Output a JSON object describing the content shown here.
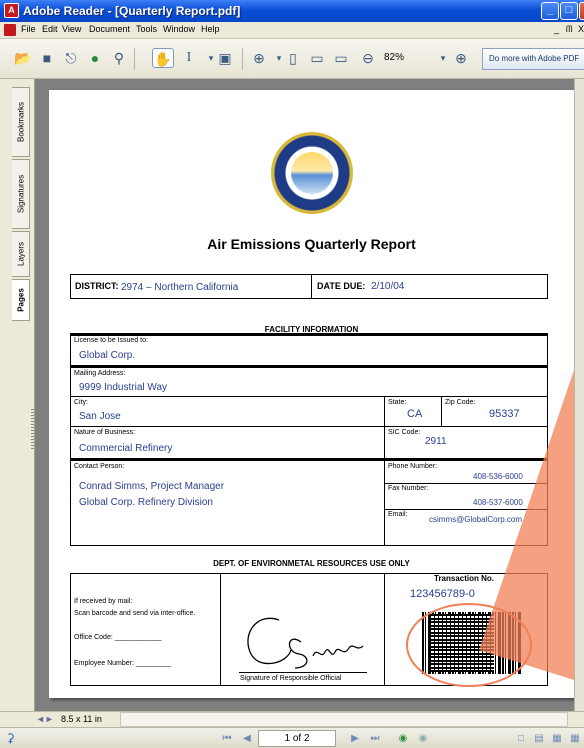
{
  "window": {
    "title": "Adobe Reader - [Quarterly Report.pdf]",
    "min": "_",
    "max": "□",
    "close": "X"
  },
  "menu": {
    "items": [
      "File",
      "Edit",
      "View",
      "Document",
      "Tools",
      "Window",
      "Help"
    ],
    "doc_min": "_",
    "doc_restore": "ᗰ",
    "doc_close": "X"
  },
  "toolbar": {
    "zoom": "82%",
    "promo": "Do more with Adobe PDF"
  },
  "nav": {
    "tabs": [
      "Bookmarks",
      "Signatures",
      "Layers",
      "Pages"
    ],
    "active": "Pages"
  },
  "document": {
    "title": "Air Emissions Quarterly Report",
    "district_label": "DISTRICT:",
    "district_value": "2974 – Northern California",
    "date_due_label": "DATE DUE:",
    "date_due_value": "2/10/04",
    "facility_header": "FACILITY INFORMATION",
    "license_label": "License to be Issued to:",
    "license_value": "Global Corp.",
    "mailing_label": "Mailing Address:",
    "mailing_value": "9999 Industrial Way",
    "city_label": "City:",
    "city_value": "San Jose",
    "state_label": "State:",
    "state_value": "CA",
    "zip_label": "Zip Code:",
    "zip_value": "95337",
    "nature_label": "Nature of Business:",
    "nature_value": "Commercial Refinery",
    "sic_label": "SIC Code:",
    "sic_value": "2911",
    "contact_label": "Contact Person:",
    "contact_line1": "Conrad Simms, Project Manager",
    "contact_line2": "Global Corp. Refinery Division",
    "phone_label": "Phone Number:",
    "phone_value": "408-536-6000",
    "fax_label": "Fax Number:",
    "fax_value": "408-537-6000",
    "email_label": "Email:",
    "email_value": "csimms@GlobalCorp.com",
    "dept_header": "DEPT. OF ENVIRONMETAL RESOURCES USE ONLY",
    "mail_line1": "If received by mail:",
    "mail_line2": "Scan barcode and send via inter-office.",
    "office_code_label": "Office Code: ____________",
    "employee_label": "Employee Number: _________",
    "signature_label": "Signature of Responsible Official",
    "transaction_label": "Transaction No.",
    "transaction_value": "123456789-0"
  },
  "status": {
    "page_size": "8.5 x 11 in",
    "page_display": "1 of 2"
  },
  "colors": {
    "title_bar": "#0a4fd8",
    "field_value": "#2a3f8f",
    "callout": "#f08057",
    "canvas": "#7f7f7f"
  }
}
